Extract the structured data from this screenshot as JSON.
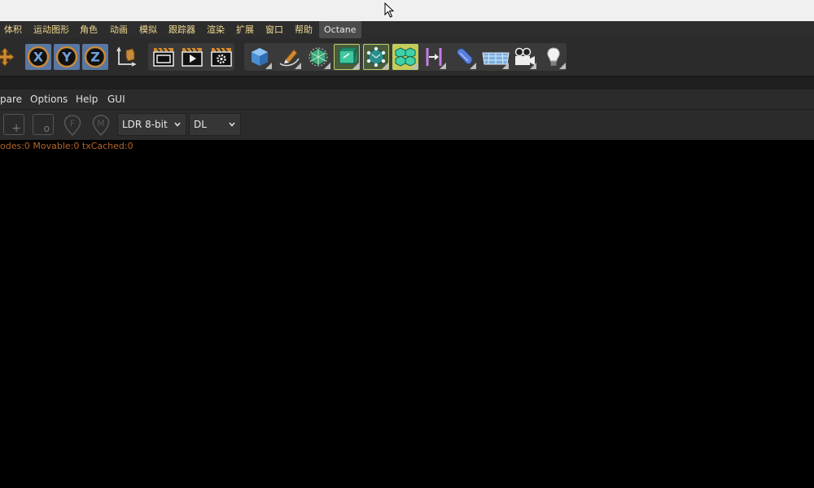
{
  "menubar": {
    "items": [
      "体积",
      "运动图形",
      "角色",
      "动画",
      "模拟",
      "跟踪器",
      "渲染",
      "扩展",
      "窗口",
      "帮助"
    ],
    "active": "Octane"
  },
  "toolbar": {
    "axis_labels": [
      "X",
      "Y",
      "Z"
    ],
    "icons": [
      "move-icon",
      "x-axis-icon",
      "y-axis-icon",
      "z-axis-icon",
      "coordinate-system-icon",
      "render-region-icon",
      "render-view-icon",
      "render-settings-icon",
      "cube-icon",
      "pen-spline-icon",
      "subdivision-icon",
      "extrude-icon",
      "cloner-icon",
      "fracture-icon",
      "deformer-icon",
      "sweep-icon",
      "floor-icon",
      "camera-icon",
      "light-icon"
    ]
  },
  "octane_menu": {
    "items": [
      "pare",
      "Options",
      "Help",
      "GUI"
    ]
  },
  "octane_toolbar": {
    "plus_label": "+",
    "o_label": "o",
    "f_label": "F",
    "m_label": "M",
    "color_depth": "LDR 8-bit",
    "kernel": "DL"
  },
  "status": {
    "text": "odes:0 Movable:0 txCached:0"
  },
  "colors": {
    "menu_text": "#f0d890",
    "status_text": "#b5652a",
    "axis_selected_bg": "#5977a3",
    "active_tool_border": "#b8cf6a"
  }
}
